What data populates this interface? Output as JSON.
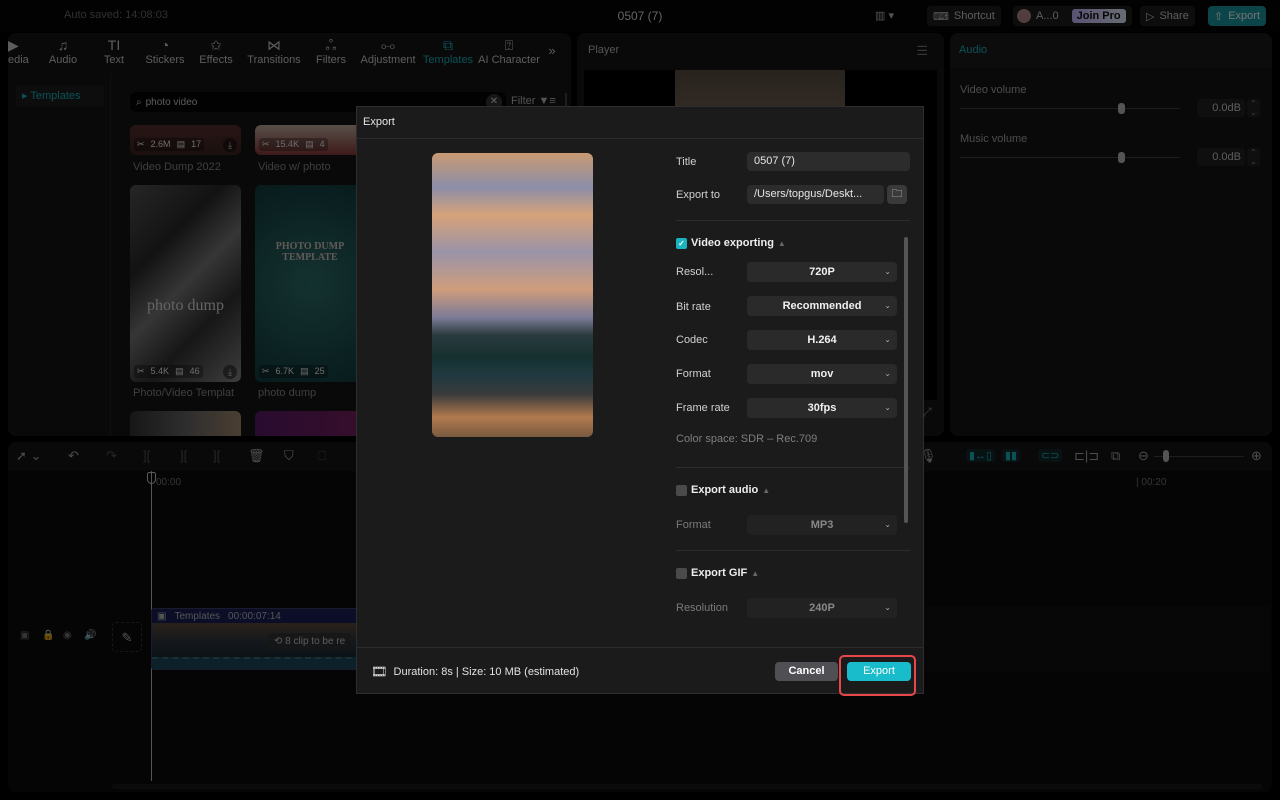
{
  "topbar": {
    "autosaved": "Auto saved: 14:08:03",
    "project_title": "0507 (7)",
    "shortcut_label": "Shortcut",
    "account_label": "A...0",
    "join_pro_label": "Join Pro",
    "share_label": "Share",
    "export_label": "Export"
  },
  "left_panel": {
    "tabs": [
      {
        "label": "edia",
        "icon": "media-icon"
      },
      {
        "label": "Audio",
        "icon": "audio-icon"
      },
      {
        "label": "Text",
        "icon": "text-icon"
      },
      {
        "label": "Stickers",
        "icon": "stickers-icon"
      },
      {
        "label": "Effects",
        "icon": "effects-icon"
      },
      {
        "label": "Transitions",
        "icon": "transitions-icon"
      },
      {
        "label": "Filters",
        "icon": "filters-icon"
      },
      {
        "label": "Adjustment",
        "icon": "adjustment-icon"
      },
      {
        "label": "Templates",
        "icon": "templates-icon",
        "active": true
      },
      {
        "label": "AI Character",
        "icon": "ai-character-icon"
      }
    ],
    "more_label": "»",
    "sidebar_item": "Templates",
    "search_value": "photo video",
    "filter_label": "Filter",
    "cards": [
      {
        "title": "Video Dump 2022",
        "uses": "2.6M",
        "clips": "17"
      },
      {
        "title": "Video w/ photo",
        "uses": "15.4K",
        "clips": "4"
      },
      {
        "title": "Photo/Video Templat",
        "uses": "5.4K",
        "clips": "46",
        "overlay": "photo dump"
      },
      {
        "title": "photo dump",
        "uses": "6.7K",
        "clips": "25",
        "overlay": "PHOTO DUMP TEMPLATE"
      }
    ]
  },
  "player": {
    "title": "Player"
  },
  "audio_panel": {
    "title": "Audio",
    "video_volume_label": "Video volume",
    "video_volume_value": "0.0dB",
    "video_volume_level": 0.73,
    "music_volume_label": "Music volume",
    "music_volume_value": "0.0dB",
    "music_volume_level": 0.73
  },
  "timeline": {
    "ruler_start": "00:00",
    "ruler_mark": "00:20",
    "clip_label": "Templates",
    "clip_duration": "00:00:07:14",
    "clip_badge": "8 clip to be re"
  },
  "export_dialog": {
    "title": "Export",
    "title_label": "Title",
    "title_value": "0507 (7)",
    "export_to_label": "Export to",
    "export_to_value": "/Users/topgus/Deskt...",
    "video_section": {
      "label": "Video exporting",
      "checked": true,
      "rows": [
        {
          "label": "Resol...",
          "value": "720P"
        },
        {
          "label": "Bit rate",
          "value": "Recommended"
        },
        {
          "label": "Codec",
          "value": "H.264"
        },
        {
          "label": "Format",
          "value": "mov"
        },
        {
          "label": "Frame rate",
          "value": "30fps"
        }
      ],
      "color_space": "Color space: SDR – Rec.709"
    },
    "audio_section": {
      "label": "Export audio",
      "checked": false,
      "format_label": "Format",
      "format_value": "MP3"
    },
    "gif_section": {
      "label": "Export GIF",
      "checked": false,
      "resolution_label": "Resolution",
      "resolution_value": "240P"
    },
    "duration_info": "Duration: 8s | Size: 10 MB (estimated)",
    "cancel_label": "Cancel",
    "export_label": "Export"
  },
  "colors": {
    "accent": "#19b4bf",
    "highlight": "#e8474a"
  }
}
